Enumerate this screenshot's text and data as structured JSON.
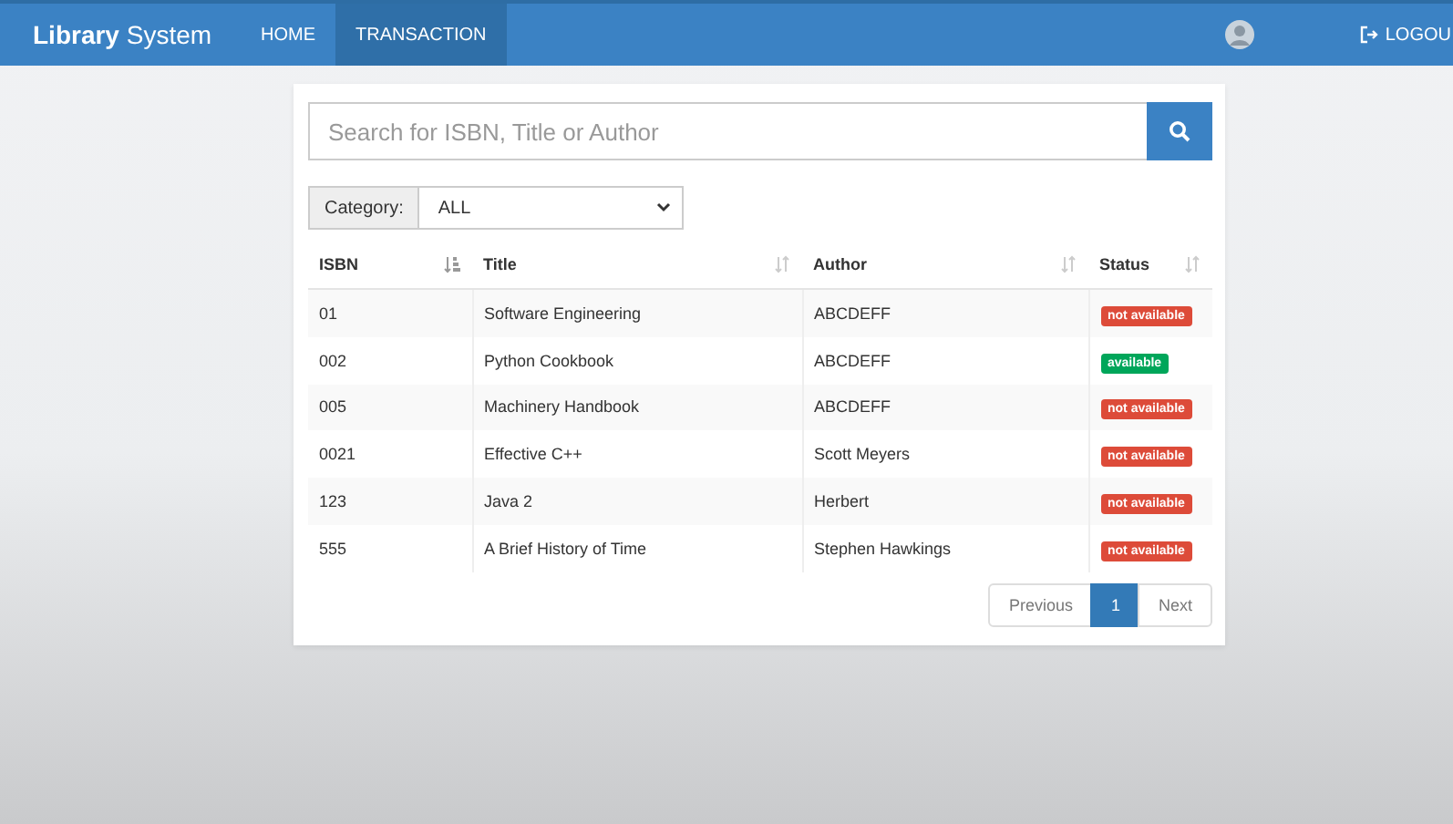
{
  "navbar": {
    "brand_bold": "Library",
    "brand_rest": "System",
    "links": [
      {
        "label": "HOME",
        "selected": false
      },
      {
        "label": "TRANSACTION",
        "selected": true
      }
    ],
    "logout": "LOGOU"
  },
  "search": {
    "placeholder": "Search for ISBN, Title or Author"
  },
  "category": {
    "label": "Category:",
    "value": "ALL"
  },
  "table": {
    "columns": [
      {
        "label": "ISBN",
        "sorted": true
      },
      {
        "label": "Title",
        "sorted": false
      },
      {
        "label": "Author",
        "sorted": false
      },
      {
        "label": "Status",
        "sorted": false
      }
    ],
    "rows": [
      {
        "isbn": "01",
        "title": "Software Engineering",
        "author": "ABCDEFF",
        "status": "not available",
        "available": false
      },
      {
        "isbn": "002",
        "title": "Python Cookbook",
        "author": "ABCDEFF",
        "status": "available",
        "available": true
      },
      {
        "isbn": "005",
        "title": "Machinery Handbook",
        "author": "ABCDEFF",
        "status": "not available",
        "available": false
      },
      {
        "isbn": "0021",
        "title": "Effective C++",
        "author": "Scott Meyers",
        "status": "not available",
        "available": false
      },
      {
        "isbn": "123",
        "title": "Java 2",
        "author": "Herbert",
        "status": "not available",
        "available": false
      },
      {
        "isbn": "555",
        "title": "A Brief History of Time",
        "author": "Stephen Hawkings",
        "status": "not available",
        "available": false
      }
    ]
  },
  "pagination": {
    "previous": "Previous",
    "pages": [
      {
        "label": "1",
        "selected": true
      }
    ],
    "next": "Next"
  }
}
